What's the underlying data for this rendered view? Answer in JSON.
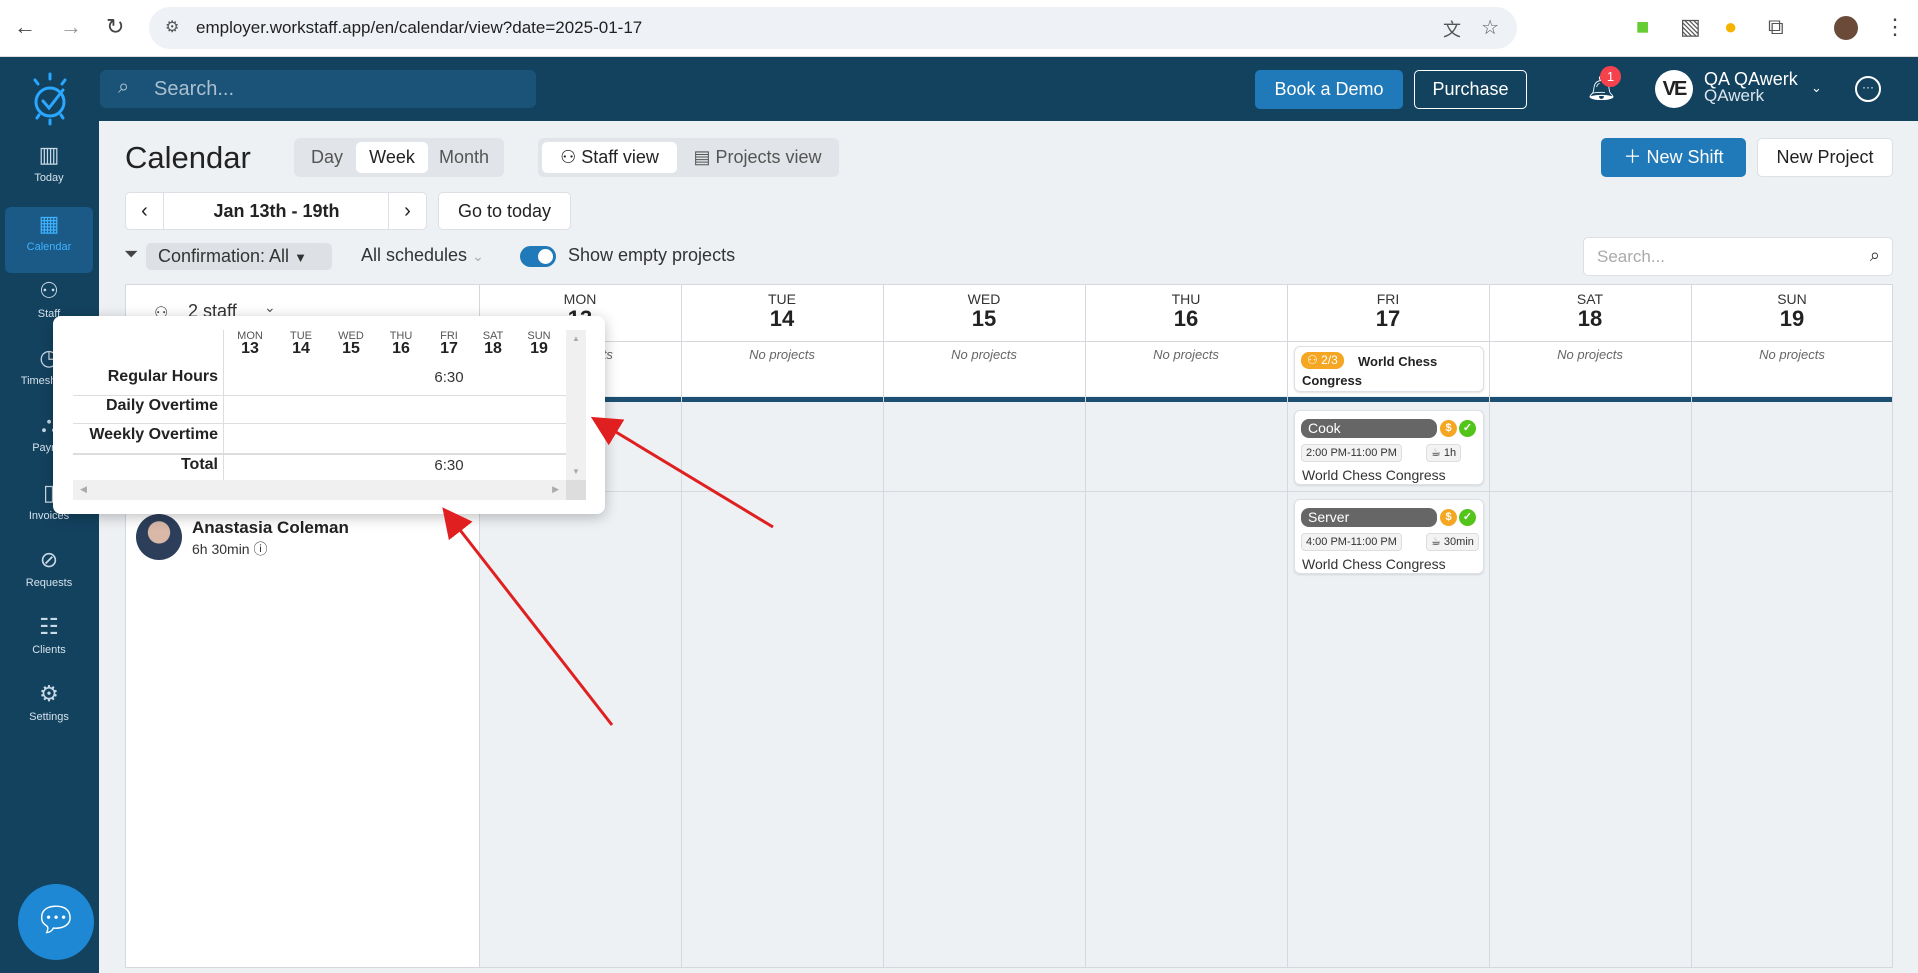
{
  "browser": {
    "url": "employer.workstaff.app/en/calendar/view?date=2025-01-17"
  },
  "topbar": {
    "search_placeholder": "Search...",
    "book_demo": "Book a Demo",
    "purchase": "Purchase",
    "notifications_count": "1",
    "user_name": "QA QAwerk",
    "company": "QAwerk",
    "avatar_initials": "VE"
  },
  "sidebar": {
    "items": [
      {
        "label": "Today",
        "icon": "board-icon"
      },
      {
        "label": "Calendar",
        "icon": "calendar-icon",
        "active": true
      },
      {
        "label": "Staff",
        "icon": "staff-icon"
      },
      {
        "label": "Timesheets",
        "icon": "clock-icon"
      },
      {
        "label": "Payroll",
        "icon": "payroll-icon"
      },
      {
        "label": "Invoices",
        "icon": "invoice-icon"
      },
      {
        "label": "Requests",
        "icon": "requests-icon"
      },
      {
        "label": "Clients",
        "icon": "clients-icon"
      },
      {
        "label": "Settings",
        "icon": "gear-icon"
      }
    ]
  },
  "calendar": {
    "title": "Calendar",
    "ranges": [
      "Day",
      "Week",
      "Month"
    ],
    "active_range": "Week",
    "views": [
      "Staff view",
      "Projects view"
    ],
    "active_view": "Staff view",
    "new_shift": "New Shift",
    "new_project": "New Project",
    "date_range": "Jan 13th - 19th",
    "go_today": "Go to today",
    "filter_confirmation": "Confirmation:  All",
    "filter_schedules": "All schedules",
    "show_empty_label": "Show empty projects",
    "show_empty_on": true,
    "search_placeholder": "Search...",
    "staff_count": "2 staff",
    "no_projects": "No projects",
    "days": [
      {
        "w": "MON",
        "n": "13"
      },
      {
        "w": "TUE",
        "n": "14"
      },
      {
        "w": "WED",
        "n": "15"
      },
      {
        "w": "THU",
        "n": "16"
      },
      {
        "w": "FRI",
        "n": "17"
      },
      {
        "w": "SAT",
        "n": "18"
      },
      {
        "w": "SUN",
        "n": "19"
      }
    ],
    "project": {
      "staffing": "2/3",
      "name": "World Chess Congress"
    },
    "shifts": [
      {
        "role": "Cook",
        "time": "2:00 PM-11:00 PM",
        "break": "1h",
        "project": "World Chess Congress"
      },
      {
        "role": "Server",
        "time": "4:00 PM-11:00 PM",
        "break": "30min",
        "project": "World Chess Congress"
      }
    ],
    "staff": [
      {
        "name": "Anastasia Coleman",
        "hours": "6h 30min"
      }
    ]
  },
  "popup": {
    "days": [
      {
        "w": "MON",
        "n": "13"
      },
      {
        "w": "TUE",
        "n": "14"
      },
      {
        "w": "WED",
        "n": "15"
      },
      {
        "w": "THU",
        "n": "16"
      },
      {
        "w": "FRI",
        "n": "17"
      },
      {
        "w": "SAT",
        "n": "18"
      },
      {
        "w": "SUN",
        "n": "19"
      }
    ],
    "rows": [
      {
        "label": "Regular Hours",
        "fri": "6:30"
      },
      {
        "label": "Daily Overtime",
        "fri": ""
      },
      {
        "label": "Weekly Overtime",
        "fri": ""
      },
      {
        "label": "Total",
        "fri": "6:30"
      }
    ]
  },
  "colors": {
    "brand_dark": "#13425f",
    "accent": "#2079b8",
    "warning": "#f5a623",
    "success": "#52c41a",
    "annotation": "#e02020"
  }
}
